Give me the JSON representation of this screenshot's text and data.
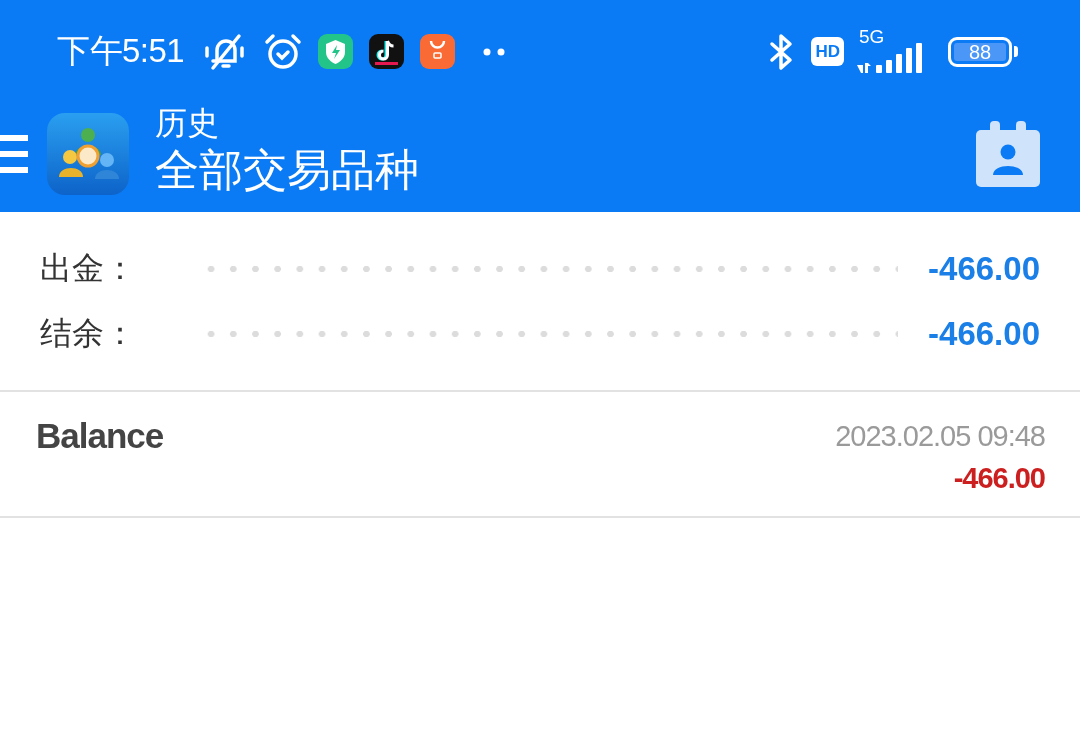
{
  "status_bar": {
    "time": "下午5:51",
    "network_badge": "HD",
    "network_type": "5G",
    "battery": "88"
  },
  "app_bar": {
    "subtitle": "历史",
    "title": "全部交易品种"
  },
  "summary": [
    {
      "label": "出金：",
      "value": "-466.00"
    },
    {
      "label": "结余：",
      "value": "-466.00"
    }
  ],
  "deals": [
    {
      "symbol": "Balance",
      "time": "2023.02.05 09:48",
      "profit": "-466.00"
    }
  ]
}
